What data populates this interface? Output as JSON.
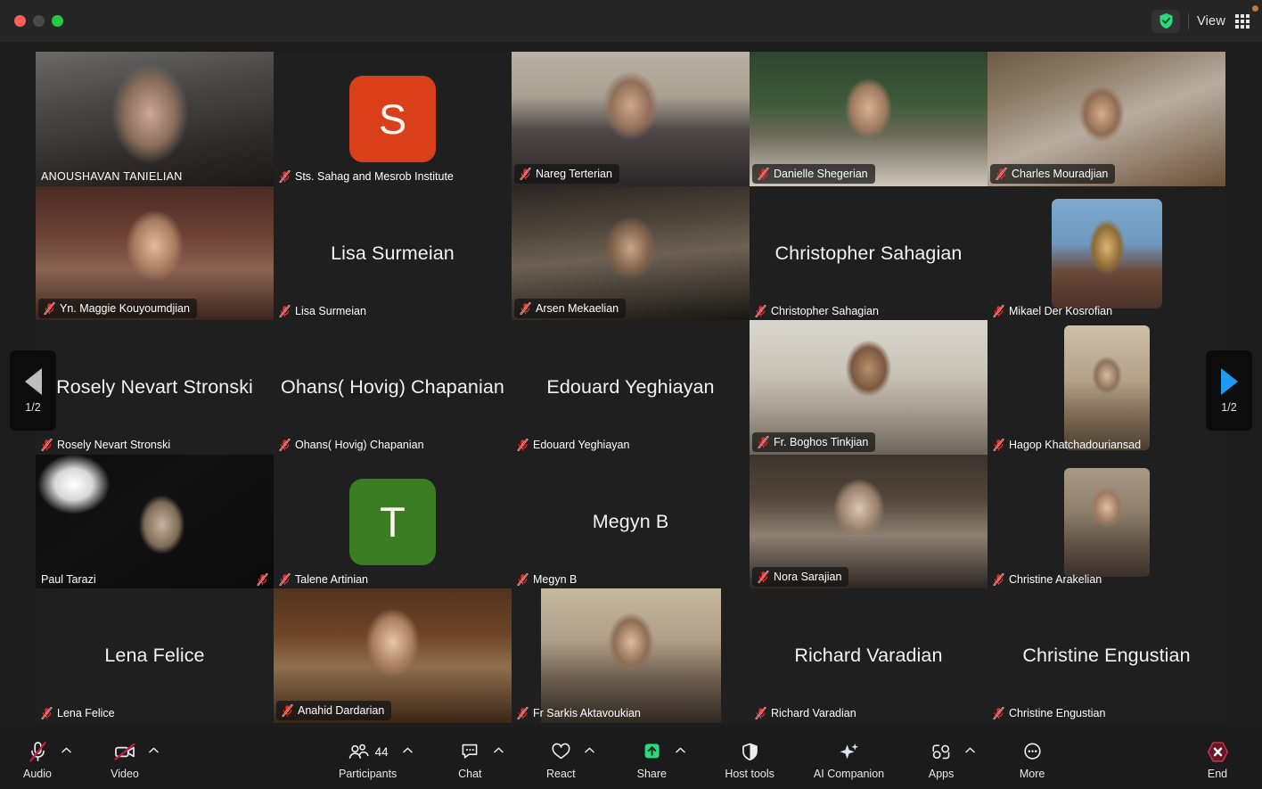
{
  "window": {
    "traffic_lights": [
      "close",
      "minimize",
      "zoom"
    ],
    "encryption_badge": "shield-check",
    "view_label": "View",
    "view_icon": "grid-icon"
  },
  "pagination": {
    "prev_label": "1/2",
    "next_label": "1/2",
    "prev_icon": "triangle-left-icon",
    "next_icon": "triangle-right-icon",
    "prev_color": "#bdbdbd",
    "next_color": "#1e9bf0"
  },
  "colors": {
    "speaking_border": "#37b24d",
    "mute_icon": "#e02b2b",
    "share_accent": "#2bd97c",
    "end_accent": "#8c1c2b",
    "avatar_s": "#d9401a",
    "avatar_t": "#3a7d22"
  },
  "participants": [
    {
      "name": "ANOUSHAVAN TANIELIAN",
      "kind": "video",
      "muted": false,
      "label_style": "plain",
      "uppercase": true,
      "art": "tanielian",
      "row": 0,
      "col": 0
    },
    {
      "name": "Sts. Sahag and Mesrob Institute",
      "kind": "avatar",
      "avatar_letter": "S",
      "avatar_color": "#d9401a",
      "muted": true,
      "label_style": "plain",
      "row": 0,
      "col": 1
    },
    {
      "name": "Nareg Terterian",
      "kind": "video",
      "muted": true,
      "label_style": "chip",
      "art": "terterian",
      "row": 0,
      "col": 2
    },
    {
      "name": "Danielle Shegerian",
      "kind": "video",
      "muted": true,
      "label_style": "chip",
      "art": "shegerian",
      "row": 0,
      "col": 3
    },
    {
      "name": "Charles Mouradjian",
      "kind": "video",
      "muted": true,
      "label_style": "chip",
      "art": "mouradjian",
      "row": 0,
      "col": 4
    },
    {
      "name": "Yn. Maggie Kouyoumdjian",
      "kind": "video",
      "muted": true,
      "label_style": "chip",
      "art": "kouyoumdjian",
      "row": 1,
      "col": 0
    },
    {
      "name": "Lisa Surmeian",
      "kind": "nameonly",
      "muted": true,
      "label_style": "plain",
      "row": 1,
      "col": 1
    },
    {
      "name": "Arsen Mekaelian",
      "kind": "video",
      "muted": true,
      "label_style": "chip",
      "art": "mekaelian",
      "row": 1,
      "col": 2
    },
    {
      "name": "Christopher Sahagian",
      "kind": "nameonly",
      "muted": true,
      "label_style": "plain",
      "row": 1,
      "col": 3
    },
    {
      "name": "Mikael Der Kosrofian",
      "kind": "video",
      "muted": true,
      "label_style": "plain",
      "art": "kosrofian",
      "row": 1,
      "col": 4
    },
    {
      "name": "Rosely Nevart Stronski",
      "kind": "nameonly",
      "muted": true,
      "label_style": "plain",
      "row": 2,
      "col": 0
    },
    {
      "name": "Ohans( Hovig) Chapanian",
      "kind": "nameonly",
      "muted": true,
      "label_style": "plain",
      "row": 2,
      "col": 1
    },
    {
      "name": "Edouard Yeghiayan",
      "kind": "nameonly",
      "muted": true,
      "label_style": "plain",
      "row": 2,
      "col": 2
    },
    {
      "name": "Fr. Boghos Tinkjian",
      "kind": "video",
      "muted": true,
      "label_style": "chip",
      "art": "tinkjian",
      "row": 2,
      "col": 3
    },
    {
      "name": "Hagop Khatchadouriansad",
      "kind": "video",
      "muted": true,
      "label_style": "plain",
      "art": "khatchadourian",
      "row": 2,
      "col": 4
    },
    {
      "name": "Paul Tarazi",
      "kind": "video",
      "muted": true,
      "label_style": "plain",
      "speaking": true,
      "mute_position": "right",
      "art": "tarazi",
      "row": 3,
      "col": 0
    },
    {
      "name": "Talene Artinian",
      "kind": "avatar",
      "avatar_letter": "T",
      "avatar_color": "#3a7d22",
      "muted": true,
      "label_style": "plain",
      "row": 3,
      "col": 1
    },
    {
      "name": "Megyn B",
      "kind": "nameonly",
      "muted": true,
      "label_style": "plain",
      "row": 3,
      "col": 2
    },
    {
      "name": "Nora Sarajian",
      "kind": "video",
      "muted": true,
      "label_style": "chip",
      "art": "sarajian",
      "row": 3,
      "col": 3
    },
    {
      "name": "Christine Arakelian",
      "kind": "video",
      "muted": true,
      "label_style": "plain",
      "art": "arakelian",
      "row": 3,
      "col": 4
    },
    {
      "name": "Lena Felice",
      "kind": "nameonly",
      "muted": true,
      "label_style": "plain",
      "row": 4,
      "col": 0
    },
    {
      "name": "Anahid Dardarian",
      "kind": "video",
      "muted": true,
      "label_style": "chip",
      "art": "dardarian",
      "row": 4,
      "col": 1
    },
    {
      "name": "Fr Sarkis Aktavoukian",
      "kind": "video",
      "muted": true,
      "label_style": "plain",
      "art": "aktavoukian",
      "row": 4,
      "col": 2
    },
    {
      "name": "Richard Varadian",
      "kind": "nameonly",
      "muted": true,
      "label_style": "plain",
      "row": 4,
      "col": 3
    },
    {
      "name": "Christine Engustian",
      "kind": "nameonly",
      "muted": true,
      "label_style": "plain",
      "row": 4,
      "col": 4
    }
  ],
  "toolbar": {
    "audio": {
      "label": "Audio",
      "icon": "microphone-muted-icon",
      "state": "muted",
      "has_caret": true
    },
    "video": {
      "label": "Video",
      "icon": "camera-off-icon",
      "state": "off",
      "has_caret": true
    },
    "participants": {
      "label": "Participants",
      "icon": "people-icon",
      "count": "44",
      "has_caret": true
    },
    "chat": {
      "label": "Chat",
      "icon": "chat-bubble-icon",
      "has_caret": true
    },
    "react": {
      "label": "React",
      "icon": "heart-icon",
      "has_caret": true
    },
    "share": {
      "label": "Share",
      "icon": "share-screen-icon",
      "has_caret": true
    },
    "host_tools": {
      "label": "Host tools",
      "icon": "shield-icon",
      "has_caret": false
    },
    "ai_companion": {
      "label": "AI Companion",
      "icon": "sparkle-icon",
      "has_caret": false
    },
    "apps": {
      "label": "Apps",
      "icon": "apps-icon",
      "has_caret": true
    },
    "more": {
      "label": "More",
      "icon": "ellipsis-circle-icon",
      "has_caret": false
    },
    "end": {
      "label": "End",
      "icon": "end-call-icon"
    }
  }
}
